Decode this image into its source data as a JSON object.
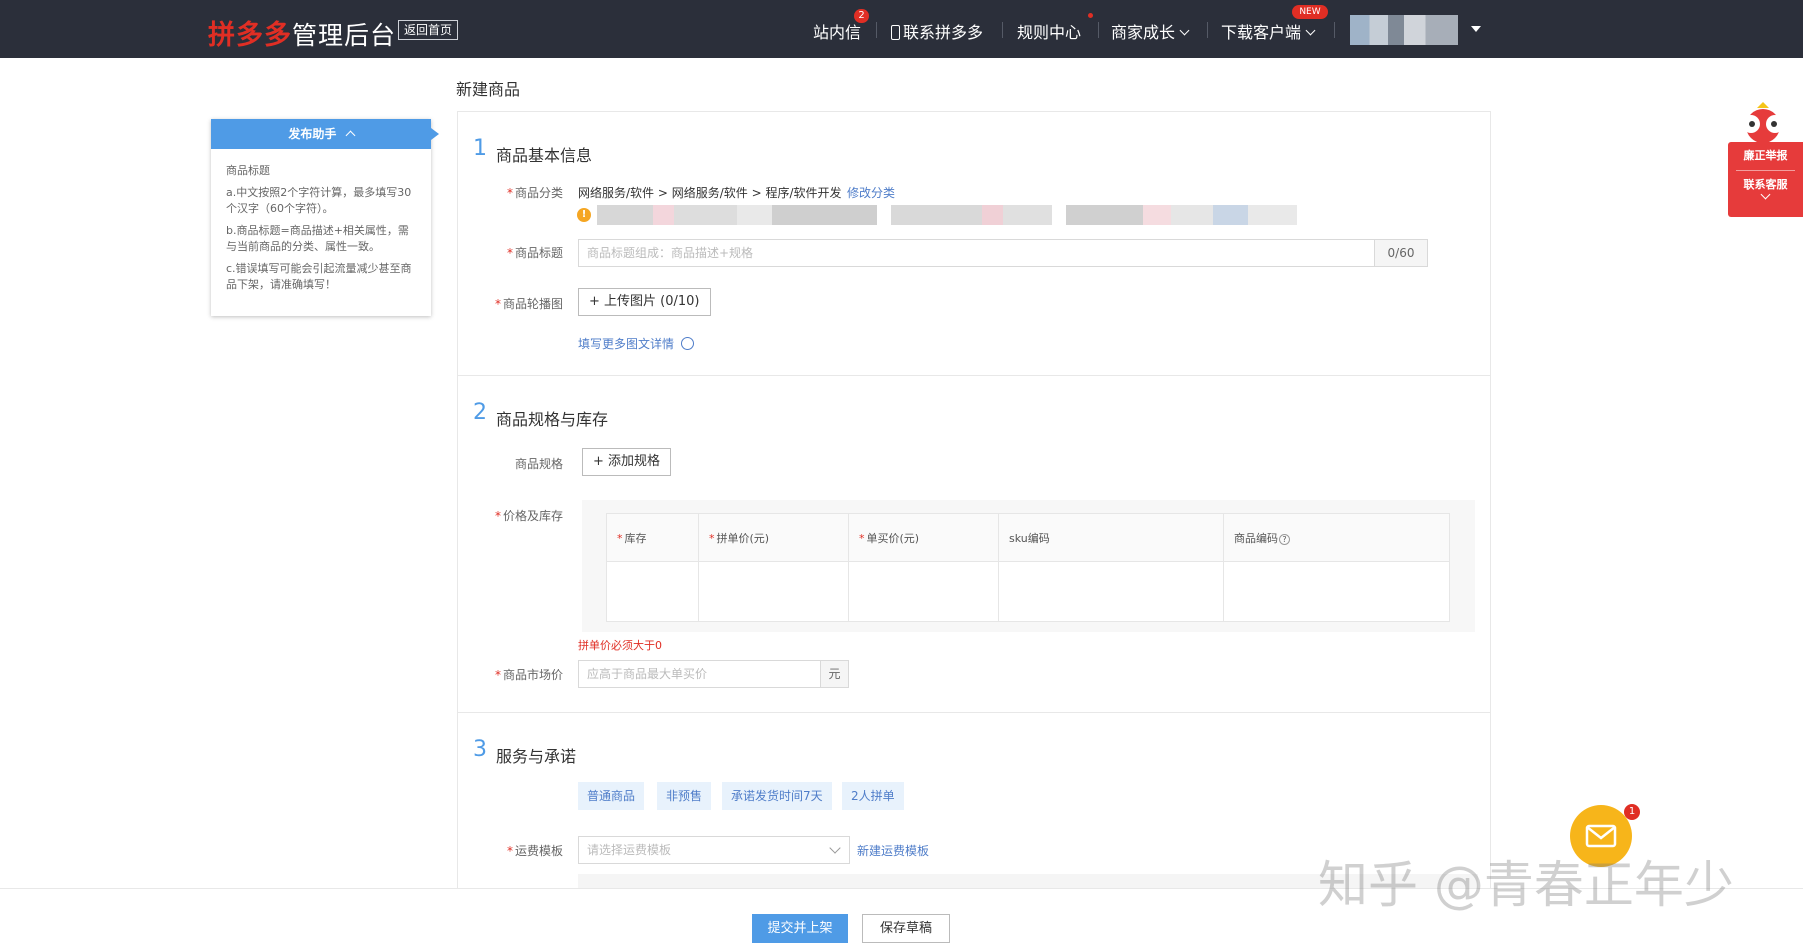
{
  "header": {
    "logo_brand": "拼多多",
    "logo_suffix": "管理后台",
    "home_button": "返回首页",
    "nav": {
      "messages": "站内信",
      "messages_badge": "2",
      "contact": "联系拼多多",
      "rules": "规则中心",
      "growth": "商家成长",
      "download": "下载客户端",
      "download_badge": "NEW"
    }
  },
  "page": {
    "title": "新建商品"
  },
  "helper": {
    "title": "发布助手",
    "heading": "商品标题",
    "tips": [
      "a.中文按照2个字符计算，最多填写30个汉字（60个字符）。",
      "b.商品标题=商品描述+相关属性，需与当前商品的分类、属性一致。",
      "c.错误填写可能会引起流量减少甚至商品下架，请准确填写！"
    ]
  },
  "section1": {
    "num": "1",
    "title": "商品基本信息",
    "category_label": "商品分类",
    "category_value": "网络服务/软件 > 网络服务/软件 > 程序/软件开发",
    "category_edit": "修改分类",
    "title_label": "商品标题",
    "title_placeholder": "商品标题组成：商品描述+规格",
    "title_count": "0/60",
    "images_label": "商品轮播图",
    "upload_button": "+ 上传图片 (0/10)",
    "more_details": "填写更多图文详情"
  },
  "section2": {
    "num": "2",
    "title": "商品规格与库存",
    "spec_label": "商品规格",
    "add_spec_button": "+ 添加规格",
    "price_label": "价格及库存",
    "table_headers": [
      "库存",
      "拼单价(元)",
      "单买价(元)",
      "sku编码",
      "商品编码"
    ],
    "error": "拼单价必须大于0",
    "market_price_label": "商品市场价",
    "market_price_placeholder": "应高于商品最大单买价",
    "market_price_unit": "元"
  },
  "section3": {
    "num": "3",
    "title": "服务与承诺",
    "tags": [
      "普通商品",
      "非预售",
      "承诺发货时间7天",
      "2人拼单"
    ],
    "shipping_label": "运费模板",
    "shipping_placeholder": "请选择运费模板",
    "new_template": "新建运费模板"
  },
  "footer": {
    "submit": "提交并上架",
    "save_draft": "保存草稿"
  },
  "float_panel": {
    "report": "廉正举报",
    "service": "联系客服"
  },
  "mail_badge": "1",
  "watermark": "知乎 @青春正年少"
}
